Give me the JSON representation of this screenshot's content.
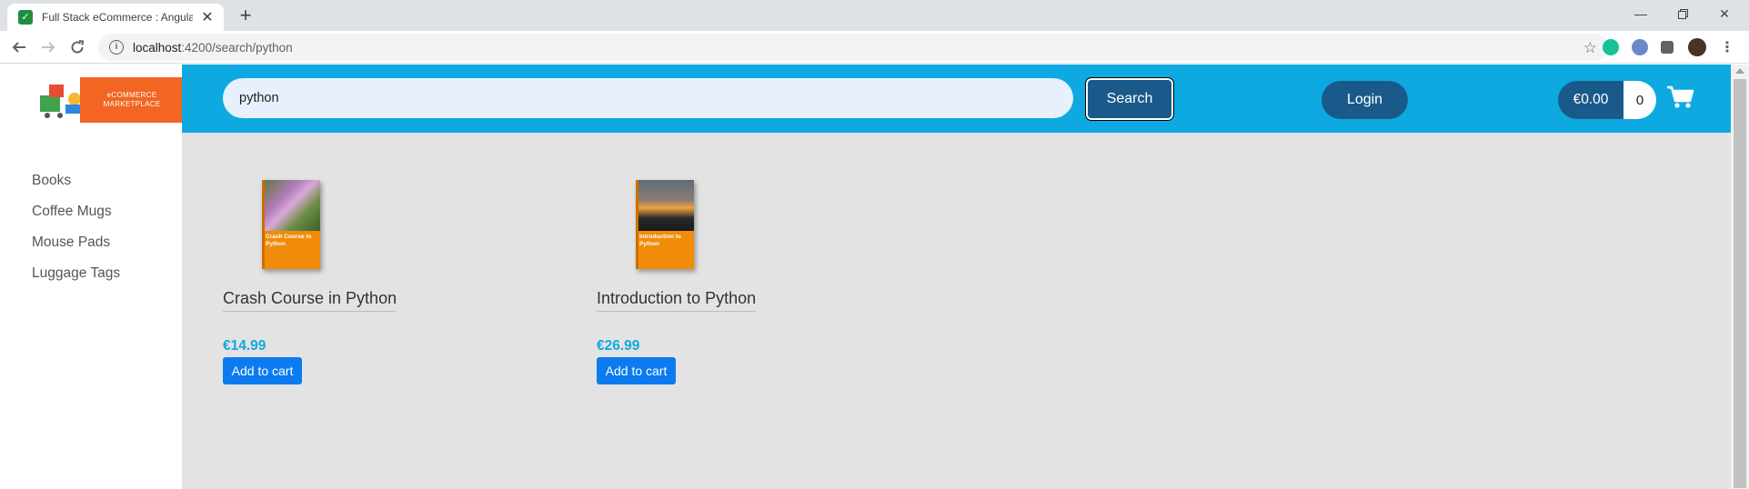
{
  "browser": {
    "tab_title": "Full Stack eCommerce : Angular a",
    "favicon": "✓",
    "url_host": "localhost",
    "url_path": ":4200/search/python"
  },
  "logo": {
    "line1": "eCOMMERCE",
    "line2": "MARKETPLACE"
  },
  "header": {
    "search_value": "python",
    "search_button": "Search",
    "login_button": "Login",
    "cart_total": "€0.00",
    "cart_count": "0"
  },
  "sidebar": {
    "items": [
      "Books",
      "Coffee Mugs",
      "Mouse Pads",
      "Luggage Tags"
    ]
  },
  "products": [
    {
      "name": "Crash Course in Python",
      "cover_text": "Crash Course in Python",
      "price": "€14.99",
      "button": "Add to cart"
    },
    {
      "name": "Introduction to Python",
      "cover_text": "Introduction to Python",
      "price": "€26.99",
      "button": "Add to cart"
    }
  ],
  "colors": {
    "header_bg": "#0da9e0",
    "button_dark": "#1a5a8a",
    "add_to_cart": "#0d7bf0",
    "logo_orange": "#f26522"
  }
}
